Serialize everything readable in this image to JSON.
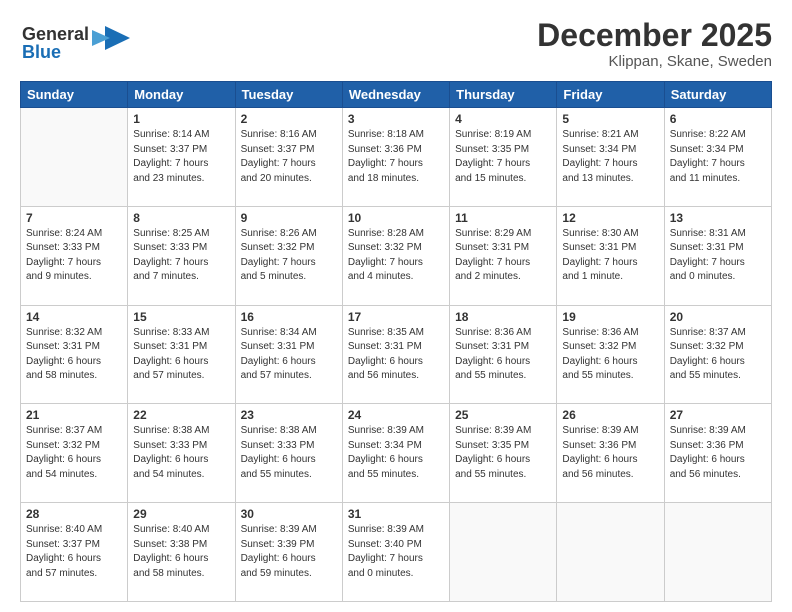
{
  "header": {
    "logo_line1": "General",
    "logo_line2": "Blue",
    "month": "December 2025",
    "location": "Klippan, Skane, Sweden"
  },
  "weekdays": [
    "Sunday",
    "Monday",
    "Tuesday",
    "Wednesday",
    "Thursday",
    "Friday",
    "Saturday"
  ],
  "weeks": [
    [
      {
        "day": "",
        "info": ""
      },
      {
        "day": "1",
        "info": "Sunrise: 8:14 AM\nSunset: 3:37 PM\nDaylight: 7 hours\nand 23 minutes."
      },
      {
        "day": "2",
        "info": "Sunrise: 8:16 AM\nSunset: 3:37 PM\nDaylight: 7 hours\nand 20 minutes."
      },
      {
        "day": "3",
        "info": "Sunrise: 8:18 AM\nSunset: 3:36 PM\nDaylight: 7 hours\nand 18 minutes."
      },
      {
        "day": "4",
        "info": "Sunrise: 8:19 AM\nSunset: 3:35 PM\nDaylight: 7 hours\nand 15 minutes."
      },
      {
        "day": "5",
        "info": "Sunrise: 8:21 AM\nSunset: 3:34 PM\nDaylight: 7 hours\nand 13 minutes."
      },
      {
        "day": "6",
        "info": "Sunrise: 8:22 AM\nSunset: 3:34 PM\nDaylight: 7 hours\nand 11 minutes."
      }
    ],
    [
      {
        "day": "7",
        "info": "Sunrise: 8:24 AM\nSunset: 3:33 PM\nDaylight: 7 hours\nand 9 minutes."
      },
      {
        "day": "8",
        "info": "Sunrise: 8:25 AM\nSunset: 3:33 PM\nDaylight: 7 hours\nand 7 minutes."
      },
      {
        "day": "9",
        "info": "Sunrise: 8:26 AM\nSunset: 3:32 PM\nDaylight: 7 hours\nand 5 minutes."
      },
      {
        "day": "10",
        "info": "Sunrise: 8:28 AM\nSunset: 3:32 PM\nDaylight: 7 hours\nand 4 minutes."
      },
      {
        "day": "11",
        "info": "Sunrise: 8:29 AM\nSunset: 3:31 PM\nDaylight: 7 hours\nand 2 minutes."
      },
      {
        "day": "12",
        "info": "Sunrise: 8:30 AM\nSunset: 3:31 PM\nDaylight: 7 hours\nand 1 minute."
      },
      {
        "day": "13",
        "info": "Sunrise: 8:31 AM\nSunset: 3:31 PM\nDaylight: 7 hours\nand 0 minutes."
      }
    ],
    [
      {
        "day": "14",
        "info": "Sunrise: 8:32 AM\nSunset: 3:31 PM\nDaylight: 6 hours\nand 58 minutes."
      },
      {
        "day": "15",
        "info": "Sunrise: 8:33 AM\nSunset: 3:31 PM\nDaylight: 6 hours\nand 57 minutes."
      },
      {
        "day": "16",
        "info": "Sunrise: 8:34 AM\nSunset: 3:31 PM\nDaylight: 6 hours\nand 57 minutes."
      },
      {
        "day": "17",
        "info": "Sunrise: 8:35 AM\nSunset: 3:31 PM\nDaylight: 6 hours\nand 56 minutes."
      },
      {
        "day": "18",
        "info": "Sunrise: 8:36 AM\nSunset: 3:31 PM\nDaylight: 6 hours\nand 55 minutes."
      },
      {
        "day": "19",
        "info": "Sunrise: 8:36 AM\nSunset: 3:32 PM\nDaylight: 6 hours\nand 55 minutes."
      },
      {
        "day": "20",
        "info": "Sunrise: 8:37 AM\nSunset: 3:32 PM\nDaylight: 6 hours\nand 55 minutes."
      }
    ],
    [
      {
        "day": "21",
        "info": "Sunrise: 8:37 AM\nSunset: 3:32 PM\nDaylight: 6 hours\nand 54 minutes."
      },
      {
        "day": "22",
        "info": "Sunrise: 8:38 AM\nSunset: 3:33 PM\nDaylight: 6 hours\nand 54 minutes."
      },
      {
        "day": "23",
        "info": "Sunrise: 8:38 AM\nSunset: 3:33 PM\nDaylight: 6 hours\nand 55 minutes."
      },
      {
        "day": "24",
        "info": "Sunrise: 8:39 AM\nSunset: 3:34 PM\nDaylight: 6 hours\nand 55 minutes."
      },
      {
        "day": "25",
        "info": "Sunrise: 8:39 AM\nSunset: 3:35 PM\nDaylight: 6 hours\nand 55 minutes."
      },
      {
        "day": "26",
        "info": "Sunrise: 8:39 AM\nSunset: 3:36 PM\nDaylight: 6 hours\nand 56 minutes."
      },
      {
        "day": "27",
        "info": "Sunrise: 8:39 AM\nSunset: 3:36 PM\nDaylight: 6 hours\nand 56 minutes."
      }
    ],
    [
      {
        "day": "28",
        "info": "Sunrise: 8:40 AM\nSunset: 3:37 PM\nDaylight: 6 hours\nand 57 minutes."
      },
      {
        "day": "29",
        "info": "Sunrise: 8:40 AM\nSunset: 3:38 PM\nDaylight: 6 hours\nand 58 minutes."
      },
      {
        "day": "30",
        "info": "Sunrise: 8:39 AM\nSunset: 3:39 PM\nDaylight: 6 hours\nand 59 minutes."
      },
      {
        "day": "31",
        "info": "Sunrise: 8:39 AM\nSunset: 3:40 PM\nDaylight: 7 hours\nand 0 minutes."
      },
      {
        "day": "",
        "info": ""
      },
      {
        "day": "",
        "info": ""
      },
      {
        "day": "",
        "info": ""
      }
    ]
  ]
}
